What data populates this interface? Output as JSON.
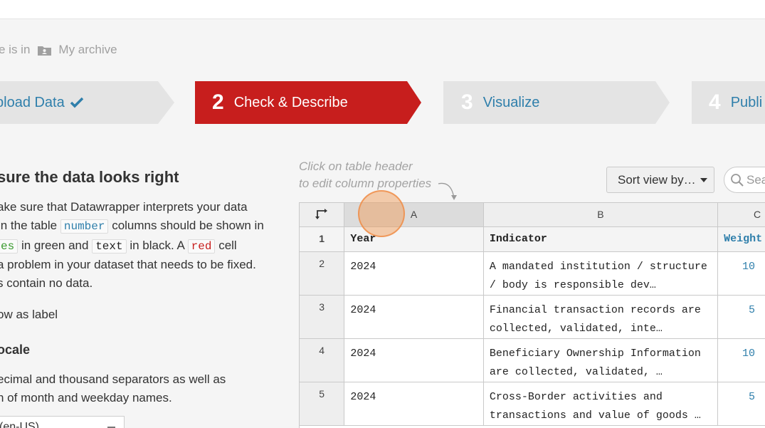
{
  "breadcrumb": {
    "prefix": "e is in",
    "folder_icon": "folder-user-icon",
    "archive": "My archive"
  },
  "steps": [
    {
      "num": "",
      "label": "pload Data",
      "state": "done",
      "icon": "check-icon"
    },
    {
      "num": "2",
      "label": "Check & Describe",
      "state": "active"
    },
    {
      "num": "3",
      "label": "Visualize",
      "state": "upcoming"
    },
    {
      "num": "4",
      "label": "Publi",
      "state": "upcoming"
    }
  ],
  "left": {
    "heading": "sure the data looks right",
    "para": {
      "l1": "ake sure that Datawrapper interprets your data",
      "l2a": "In the table",
      "code_number": "number",
      "l2b": "columns should be shown in",
      "code_dates": "es",
      "l3a": "in green and",
      "code_text": "text",
      "l3b": "in black. A",
      "code_red": "red",
      "l3c": "cell",
      "l4": "a problem in your dataset that needs to be fixed.",
      "l5": "s contain no data."
    },
    "row_label": "ow as label",
    "locale_heading": "ocale",
    "locale_desc_1": "ecimal and thousand separators as well as",
    "locale_desc_2": "n of month and weekday names.",
    "locale_value": "(en-US)"
  },
  "hint": {
    "line1": "Click on table header",
    "line2": "to edit column properties"
  },
  "sort_button": "Sort view by…",
  "search_placeholder": "Sea",
  "grid": {
    "columns": [
      "A",
      "B",
      "C"
    ],
    "header_row": {
      "num": "1",
      "cells": [
        "Year",
        "Indicator",
        "Weight"
      ]
    },
    "rows": [
      {
        "num": "2",
        "year": "2024",
        "indicator_1": "A mandated institution / structure",
        "indicator_2": "/ body is responsible dev…",
        "weight": "10"
      },
      {
        "num": "3",
        "year": "2024",
        "indicator_1": "Financial transaction records are",
        "indicator_2": "collected, validated, inte…",
        "weight": "5"
      },
      {
        "num": "4",
        "year": "2024",
        "indicator_1": "Beneficiary Ownership Information",
        "indicator_2": "are collected, validated, …",
        "weight": "10"
      },
      {
        "num": "5",
        "year": "2024",
        "indicator_1": "Cross-Border activities and",
        "indicator_2": "transactions and value of goods …",
        "weight": "5"
      }
    ]
  },
  "colors": {
    "active_step": "#c71e1d",
    "inactive_step": "#e4e4e4",
    "link_blue": "#2f7fab"
  }
}
